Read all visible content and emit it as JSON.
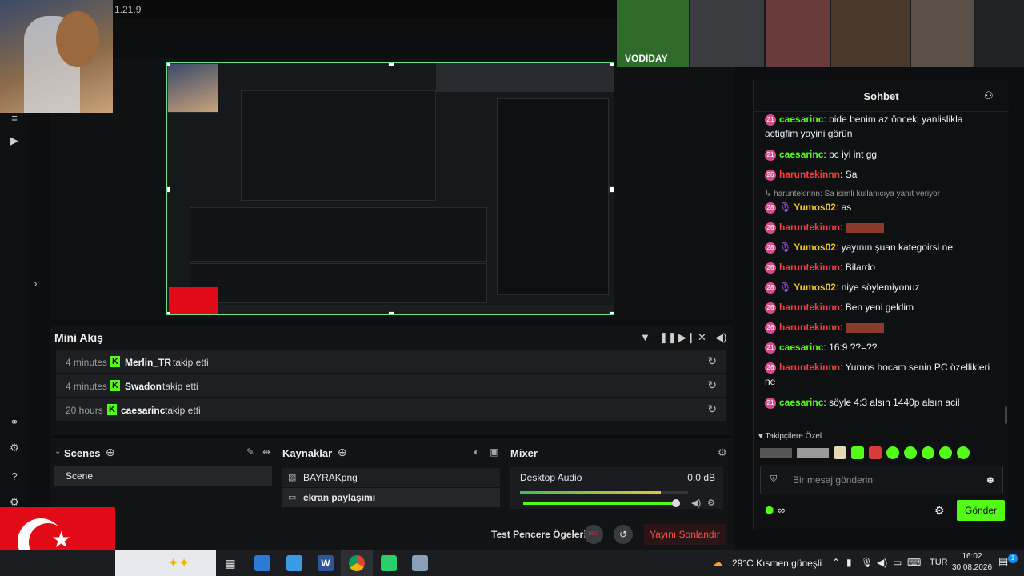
{
  "app": {
    "version": "1.21.9"
  },
  "mini_akis": {
    "title": "Mini Akış",
    "rows": [
      {
        "time": "4 minutes",
        "user": "Merlin_TR",
        "action": "takip etti"
      },
      {
        "time": "4 minutes",
        "user": "Swadon",
        "action": "takip etti"
      },
      {
        "time": "20 hours",
        "user": "caesarinc",
        "action": "takip etti"
      }
    ]
  },
  "scenes": {
    "title": "Scenes",
    "items": [
      "Scene"
    ]
  },
  "sources": {
    "title": "Kaynaklar",
    "items": [
      "BAYRAKpng",
      "ekran paylaşımı"
    ]
  },
  "mixer": {
    "title": "Mixer",
    "track": "Desktop Audio",
    "level": "0.0 dB",
    "volume_fraction": 0.95
  },
  "footer": {
    "test_label": "Test Pencere Ögeleri",
    "rec_label": "REC",
    "end_stream": "Yayını Sonlandır"
  },
  "chat": {
    "title": "Sohbet",
    "messages": [
      {
        "badge": "21",
        "user": "caesarinc",
        "color": "green",
        "text": "bide benim az önceki yanlislikla actigfim yayini görün"
      },
      {
        "badge": "21",
        "user": "caesarinc",
        "color": "green",
        "text": "pc iyi int gg"
      },
      {
        "badge": "26",
        "user": "haruntekinnn",
        "color": "red",
        "text": "Sa"
      },
      {
        "reply": "haruntekinnn: Sa isimli kullanıcıya yanıt veriyor"
      },
      {
        "badge": "28",
        "user": "Yumos02",
        "color": "yellow",
        "mic": true,
        "text": "as"
      },
      {
        "badge": "26",
        "user": "haruntekinnn",
        "color": "red",
        "text": ""
      },
      {
        "badge": "28",
        "user": "Yumos02",
        "color": "yellow",
        "mic": true,
        "text": "yayının şuan kategoirsi ne"
      },
      {
        "badge": "26",
        "user": "haruntekinnn",
        "color": "red",
        "text": "Bilardo"
      },
      {
        "badge": "28",
        "user": "Yumos02",
        "color": "yellow",
        "mic": true,
        "text": "niye söylemiyonuz"
      },
      {
        "badge": "26",
        "user": "haruntekinnn",
        "color": "red",
        "text": "Ben yeni geldim"
      },
      {
        "badge": "26",
        "user": "haruntekinnn",
        "color": "red",
        "text": ""
      },
      {
        "badge": "21",
        "user": "caesarinc",
        "color": "green",
        "text": "16:9 ??=??"
      },
      {
        "badge": "26",
        "user": "haruntekinnn",
        "color": "red",
        "text": "Yumos hocam senin PC özellikleri ne"
      },
      {
        "badge": "21",
        "user": "caesarinc",
        "color": "green",
        "text": "söyle 4:3 alsın 1440p alsın acil"
      }
    ],
    "followers_only": "Takipçilere Özel",
    "input_placeholder": "Bir mesaj gönderin",
    "send": "Gönder"
  },
  "streamer_label": "VODİDAY",
  "taskbar": {
    "weather": "29°C  Kısmen güneşli",
    "lang": "TUR",
    "time": "16:02",
    "date": "30.08.2026",
    "notif_count": "1"
  }
}
